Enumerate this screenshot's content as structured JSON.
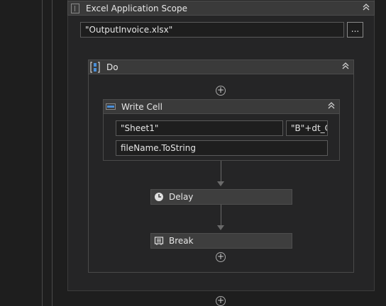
{
  "excel_scope": {
    "title": "Excel Application Scope",
    "workbook_path": "\"OutputInvoice.xlsx\"",
    "browse_label": "..."
  },
  "do_sequence": {
    "title": "Do"
  },
  "write_cell": {
    "title": "Write Cell",
    "sheet_name": "\"Sheet1\"",
    "range": "\"B\"+dt_C",
    "value": "fileName.ToString"
  },
  "delay": {
    "title": "Delay"
  },
  "break": {
    "title": "Break"
  },
  "icons": {
    "collapse": "double-chevron-up-icon",
    "add": "plus-circle-icon"
  },
  "colors": {
    "background": "#1e1e1e",
    "header": "#3a3a3a",
    "accent_blue": "#4a8fd8"
  }
}
